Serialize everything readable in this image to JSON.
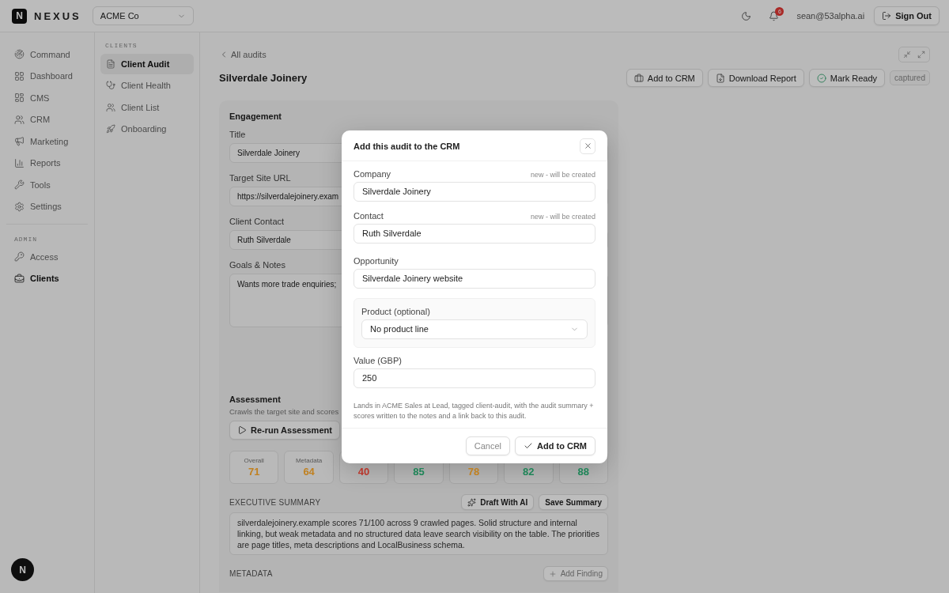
{
  "app": {
    "logo_letter": "N",
    "name": "NEXUS"
  },
  "org_select": {
    "value": "ACME Co"
  },
  "topbar": {
    "notifications": "6",
    "user": "sean@53alpha.ai",
    "sign_out": "Sign Out"
  },
  "nav": {
    "items": [
      {
        "label": "Command",
        "selected": false
      },
      {
        "label": "Dashboard",
        "selected": false
      },
      {
        "label": "CMS",
        "selected": false
      },
      {
        "label": "CRM",
        "selected": false
      },
      {
        "label": "Marketing",
        "selected": false
      },
      {
        "label": "Reports",
        "selected": false
      },
      {
        "label": "Tools",
        "selected": false
      },
      {
        "label": "Settings",
        "selected": false
      }
    ],
    "section": "ADMIN",
    "admin_items": [
      {
        "label": "Access",
        "selected": false
      },
      {
        "label": "Clients",
        "selected": true
      }
    ]
  },
  "subnav": {
    "heading": "CLIENTS",
    "items": [
      {
        "label": "Client Audit",
        "selected": true
      },
      {
        "label": "Client Health",
        "selected": false
      },
      {
        "label": "Client List",
        "selected": false
      },
      {
        "label": "Onboarding",
        "selected": false
      }
    ]
  },
  "page": {
    "back": "All audits",
    "title": "Silverdale Joinery",
    "actions": [
      {
        "label": "Add to CRM",
        "kind": "crm"
      },
      {
        "label": "Download Report",
        "kind": "download"
      },
      {
        "label": "Mark Ready",
        "kind": "ready"
      }
    ],
    "status": "captured"
  },
  "engagement": {
    "heading": "Engagement",
    "fields": [
      {
        "label": "Title",
        "value": "Silverdale Joinery",
        "kind": "input"
      },
      {
        "label": "Target Site URL",
        "value": "https://silverdalejoinery.exam",
        "kind": "input"
      },
      {
        "label": "Client Contact",
        "value": "Ruth Silverdale",
        "kind": "input"
      },
      {
        "label": "Goals & Notes",
        "value": "Wants more trade enquiries;",
        "kind": "textarea"
      }
    ]
  },
  "assessment": {
    "heading": "Assessment",
    "description": "Crawls the target site and scores",
    "rerun": "Re-run Assessment",
    "scores": [
      {
        "label": "Overall",
        "value": "71",
        "color": "#c08020"
      },
      {
        "label": "Metadata",
        "value": "64",
        "color": "#c08020"
      },
      {
        "value": "40",
        "color": "#b8352a"
      },
      {
        "value": "85",
        "color": "#1f8558"
      },
      {
        "value": "78",
        "color": "#c08020"
      },
      {
        "value": "82",
        "color": "#1f8558"
      },
      {
        "value": "88",
        "color": "#1f8558"
      }
    ]
  },
  "summary": {
    "heading": "EXECUTIVE SUMMARY",
    "draft": "Draft With AI",
    "save": "Save Summary",
    "text": "silverdalejoinery.example scores 71/100 across 9 crawled pages. Solid structure and internal linking, but weak metadata and no structured data leave search visibility on the table. The priorities are page titles, meta descriptions and LocalBusiness schema."
  },
  "metadata": {
    "heading": "METADATA",
    "add": "Add Finding"
  },
  "modal": {
    "title": "Add this audit to the CRM",
    "fields": [
      {
        "label": "Company",
        "hint": "new - will be created",
        "value": "Silverdale Joinery",
        "kind": "input"
      },
      {
        "label": "Contact",
        "hint": "new - will be created",
        "value": "Ruth Silverdale",
        "kind": "input"
      },
      {
        "label": "Opportunity",
        "value": "Silverdale Joinery website",
        "kind": "input"
      },
      {
        "label": "Product (optional)",
        "value": "No product line",
        "kind": "select"
      },
      {
        "label": "Value (GBP)",
        "value": "250",
        "kind": "input"
      }
    ],
    "note": "Lands in ACME Sales at Lead, tagged client-audit, with the audit summary + scores written to the notes and a link back to this audit.",
    "cancel": "Cancel",
    "confirm": "Add to CRM"
  },
  "fab": {
    "letter": "N"
  }
}
